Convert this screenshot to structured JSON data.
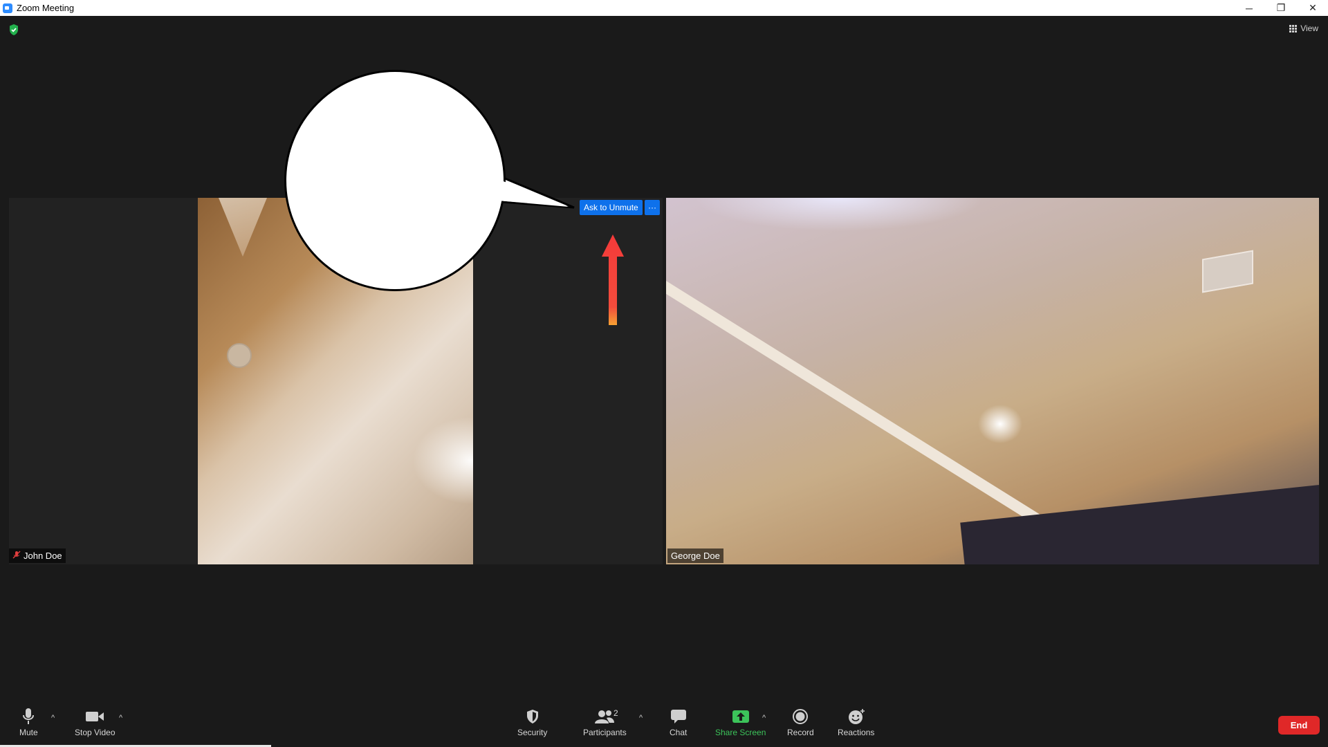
{
  "window": {
    "title": "Zoom Meeting",
    "controls": {
      "minimize": "─",
      "restore": "❐",
      "close": "✕"
    }
  },
  "header": {
    "view_label": "View"
  },
  "participants": [
    {
      "name": "John Doe",
      "muted": true
    },
    {
      "name": "George Doe",
      "muted": false
    }
  ],
  "hover_menu": {
    "ask_to_unmute": "Ask to Unmute",
    "more": "···"
  },
  "toolbar": {
    "mute": "Mute",
    "stop_video": "Stop Video",
    "security": "Security",
    "participants": "Participants",
    "participants_count": "2",
    "chat": "Chat",
    "share_screen": "Share Screen",
    "record": "Record",
    "reactions": "Reactions",
    "end": "End",
    "caret": "^"
  },
  "colors": {
    "accent": "#0e71eb",
    "share": "#3cc35a",
    "end": "#e02828",
    "annotation_arrow": "#f44040"
  }
}
